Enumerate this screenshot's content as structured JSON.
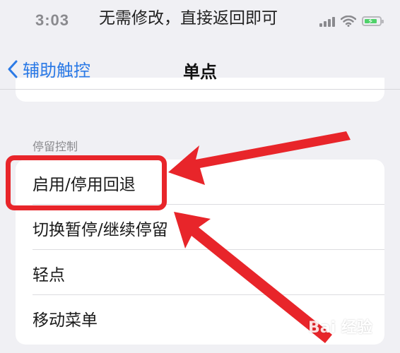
{
  "status_bar": {
    "time": "3:03",
    "caption": "无需修改，直接返回即可",
    "icons": [
      "cellular-signal-icon",
      "wifi-icon",
      "battery-charging-icon"
    ],
    "battery_level": 0.85
  },
  "nav": {
    "back_label": "辅助触控",
    "title": "单点",
    "accent_color": "#2b7ae6"
  },
  "section": {
    "header": "停留控制",
    "options": [
      {
        "label": "启用/停用回退",
        "highlighted": true
      },
      {
        "label": "切换暂停/继续停留"
      },
      {
        "label": "轻点"
      },
      {
        "label": "移动菜单"
      }
    ]
  },
  "annotation": {
    "color": "#e8252a"
  },
  "watermark": {
    "text": "Bai 经验"
  }
}
